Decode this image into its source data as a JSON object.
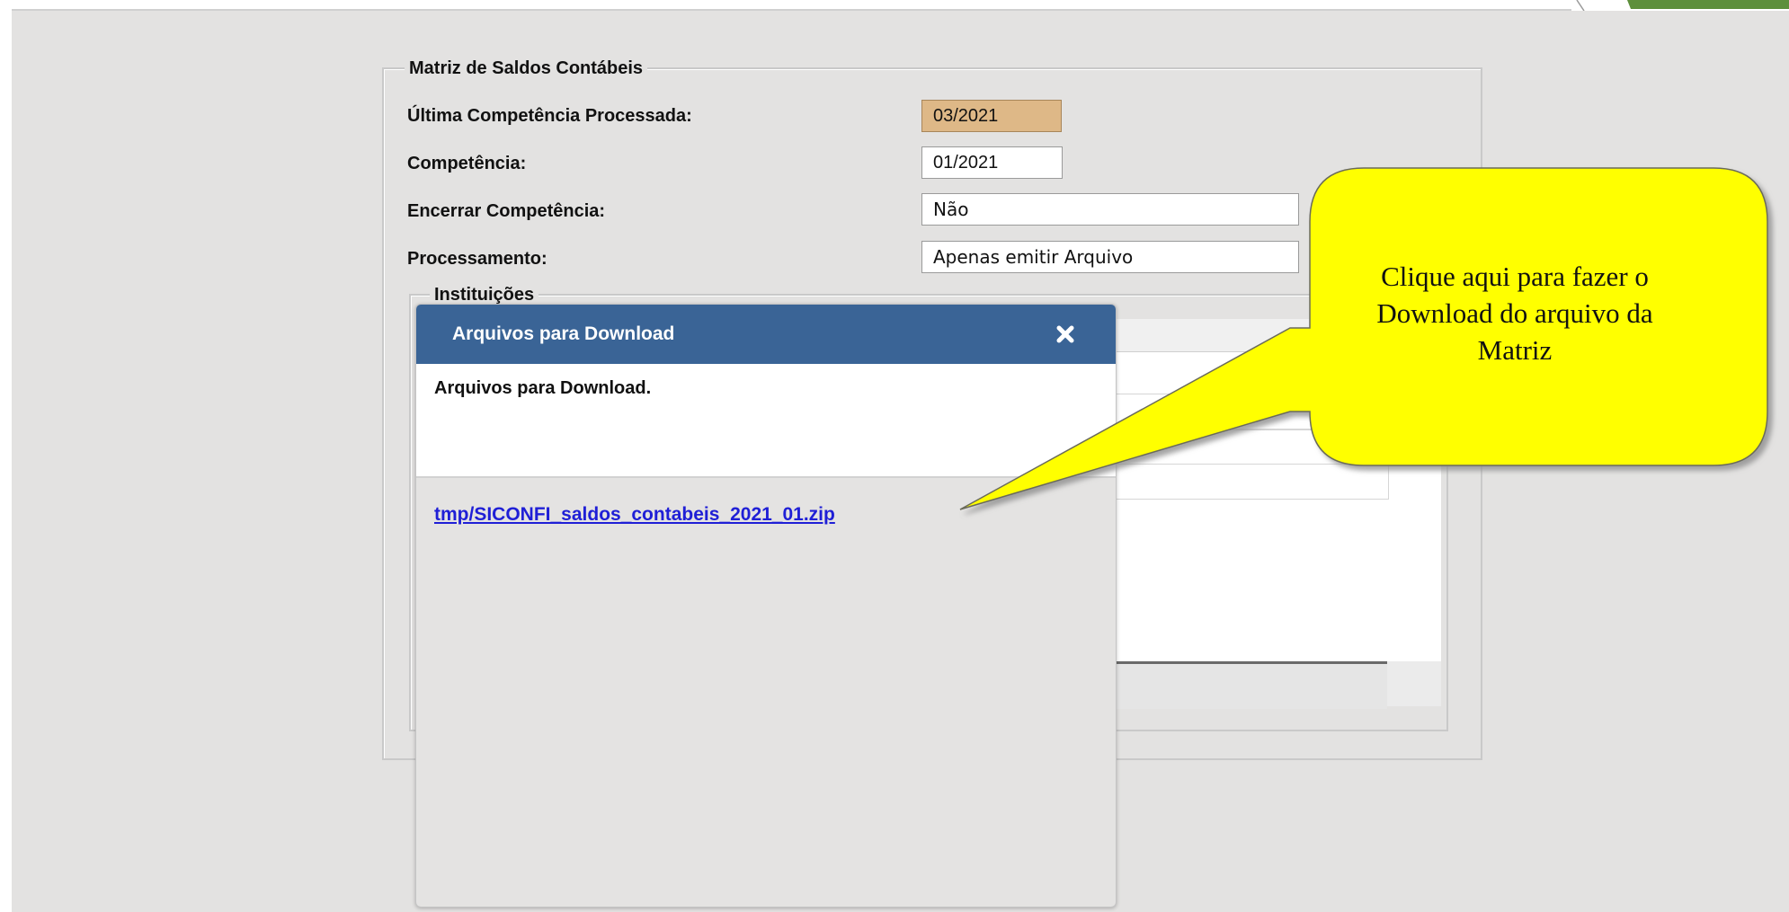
{
  "form": {
    "legend": "Matriz de Saldos Contábeis",
    "ultima_label": "Última Competência Processada:",
    "ultima_value": "03/2021",
    "competencia_label": "Competência:",
    "competencia_value": "01/2021",
    "encerrar_label": "Encerrar Competência:",
    "encerrar_value": "Não",
    "processamento_label": "Processamento:",
    "processamento_value": "Apenas emitir Arquivo",
    "instituicoes_legend": "Instituições"
  },
  "modal": {
    "title": "Arquivos para Download",
    "message": "Arquivos para Download.",
    "link": "tmp/SICONFI_saldos_contabeis_2021_01.zip"
  },
  "callout": {
    "text": "Clique aqui para fazer o\nDownload do arquivo da\nMatriz"
  },
  "colors": {
    "modal_header": "#3a6496",
    "readonly_field": "#deb887",
    "callout_fill": "#ffff00",
    "link": "#1f1fd6",
    "corner_accent": "#5d8f3b"
  }
}
